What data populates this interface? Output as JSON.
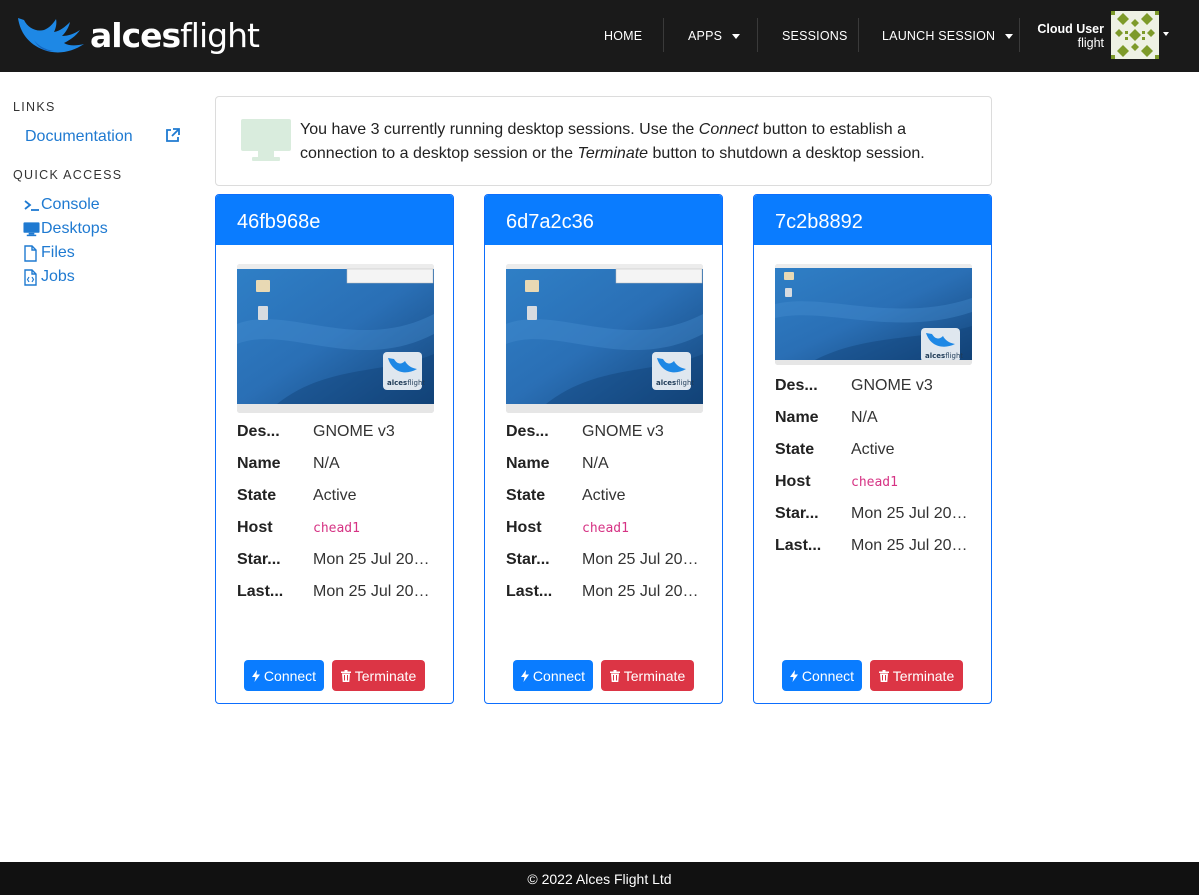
{
  "colors": {
    "accent": "#0a7cff",
    "danger": "#dc3545",
    "navbar": "#1a1a1a",
    "host_code": "#d63384",
    "icon_green": "#d9ecdd",
    "avatar_green": "#7d9a2a"
  },
  "navbar": {
    "brand_bold": "alces",
    "brand_light": "flight",
    "items": [
      {
        "label": "HOME",
        "dropdown": false
      },
      {
        "label": "APPS",
        "dropdown": true
      },
      {
        "label": "SESSIONS",
        "dropdown": false
      },
      {
        "label": "LAUNCH SESSION",
        "dropdown": true
      }
    ],
    "user": {
      "name": "Cloud User",
      "username": "flight",
      "icon": "avatar-identicon"
    }
  },
  "sidebar": {
    "links_heading": "LINKS",
    "documentation": {
      "label": "Documentation",
      "icon": "external-link-icon"
    },
    "quick_access_heading": "QUICK ACCESS",
    "quick_access": [
      {
        "label": "Console",
        "icon": "terminal-icon"
      },
      {
        "label": "Desktops",
        "icon": "desktop-icon"
      },
      {
        "label": "Files",
        "icon": "file-icon"
      },
      {
        "label": "Jobs",
        "icon": "code-file-icon"
      }
    ]
  },
  "alert": {
    "icon": "monitor-icon",
    "t1": "You have 3 currently running desktop sessions. Use the ",
    "t2": "Connect",
    "t3": " button to establish a connection to a desktop session or the ",
    "t4": "Terminate",
    "t5": " button to shutdown a desktop session."
  },
  "sessions": [
    {
      "id": "46fb968e",
      "rows": [
        {
          "key": "Des...",
          "value": "GNOME v3"
        },
        {
          "key": "Name",
          "value": "N/A"
        },
        {
          "key": "State",
          "value": "Active"
        },
        {
          "key": "Host",
          "value": "chead1"
        },
        {
          "key": "Star...",
          "value": "Mon 25 Jul 202..."
        },
        {
          "key": "Last...",
          "value": "Mon 25 Jul 202..."
        }
      ],
      "connect_label": "Connect",
      "terminate_label": "Terminate"
    },
    {
      "id": "6d7a2c36",
      "rows": [
        {
          "key": "Des...",
          "value": "GNOME v3"
        },
        {
          "key": "Name",
          "value": "N/A"
        },
        {
          "key": "State",
          "value": "Active"
        },
        {
          "key": "Host",
          "value": "chead1"
        },
        {
          "key": "Star...",
          "value": "Mon 25 Jul 202..."
        },
        {
          "key": "Last...",
          "value": "Mon 25 Jul 202..."
        }
      ],
      "connect_label": "Connect",
      "terminate_label": "Terminate"
    },
    {
      "id": "7c2b8892",
      "rows": [
        {
          "key": "Des...",
          "value": "GNOME v3"
        },
        {
          "key": "Name",
          "value": "N/A"
        },
        {
          "key": "State",
          "value": "Active"
        },
        {
          "key": "Host",
          "value": "chead1"
        },
        {
          "key": "Star...",
          "value": "Mon 25 Jul 202..."
        },
        {
          "key": "Last...",
          "value": "Mon 25 Jul 202..."
        }
      ],
      "connect_label": "Connect",
      "terminate_label": "Terminate"
    }
  ],
  "screenshot_logo_bold": "alces",
  "screenshot_logo_light": "flight",
  "footer": {
    "copyright": "© 2022 Alces Flight Ltd"
  }
}
